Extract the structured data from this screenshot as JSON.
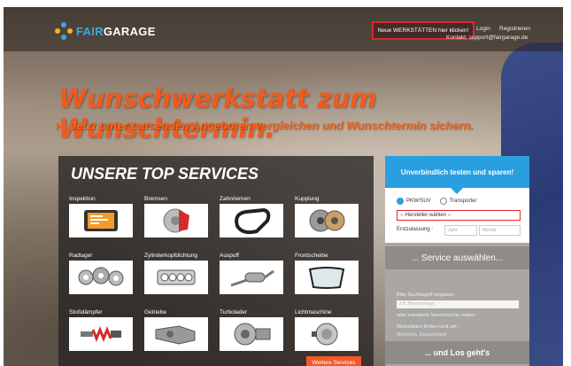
{
  "header": {
    "logo_fair": "FAIR",
    "logo_garage": "GARAGE",
    "highlight_button": "Neue WERKSTÄTTEN hier klicken!",
    "login": "Login",
    "register": "Registrieren",
    "contact": "Kontakt: support@fairgarage.de"
  },
  "hero": {
    "headline": "Wunschwerkstatt zum Wunschtermin.",
    "subline": "Jetzt unter tausenden Angeboten vergleichen und Wunschtermin sichern."
  },
  "services": {
    "title": "UNSERE TOP SERVICES",
    "items": [
      {
        "label": "Inspektion",
        "icon": "tablet-inspection-icon"
      },
      {
        "label": "Bremsen",
        "icon": "brake-disc-icon"
      },
      {
        "label": "Zahnriemen",
        "icon": "timing-belt-icon"
      },
      {
        "label": "Kupplung",
        "icon": "clutch-icon"
      },
      {
        "label": "Radlager",
        "icon": "wheel-bearing-icon"
      },
      {
        "label": "Zylinderkopfdichtung",
        "icon": "head-gasket-icon"
      },
      {
        "label": "Auspuff",
        "icon": "exhaust-icon"
      },
      {
        "label": "Frontscheibe",
        "icon": "windshield-icon"
      },
      {
        "label": "Stoßdämpfer",
        "icon": "shock-absorber-icon"
      },
      {
        "label": "Getriebe",
        "icon": "gearbox-icon"
      },
      {
        "label": "Turbolader",
        "icon": "turbocharger-icon"
      },
      {
        "label": "Lichtmaschine",
        "icon": "alternator-icon"
      }
    ],
    "more_button": "Weitere Services"
  },
  "sidebar": {
    "title": "Unverbindlich testen und sparen!",
    "radio_pkw": "PKW/SUV",
    "radio_transporter": "Transporter",
    "manufacturer_select": "-- Hersteller wählen --",
    "registration_label": "Erstzulassung :",
    "year_placeholder": "Jahr",
    "month_placeholder": "Monat",
    "service_bar": "... Service auswählen...",
    "search_label": "Bitte Suchbegriff eingeben:",
    "search_placeholder": "z.B. Bremsbelage",
    "advanced_text": "oder erweiterte Servicesuche nutzen",
    "workshop_label": "Werkstätten finden rund um:",
    "location_value": "München, Deutschland",
    "go_bar": "... und Los geht's"
  },
  "colors": {
    "accent_orange": "#ef5b1f",
    "accent_blue": "#2a9fe0",
    "highlight_red": "#e0262b"
  }
}
